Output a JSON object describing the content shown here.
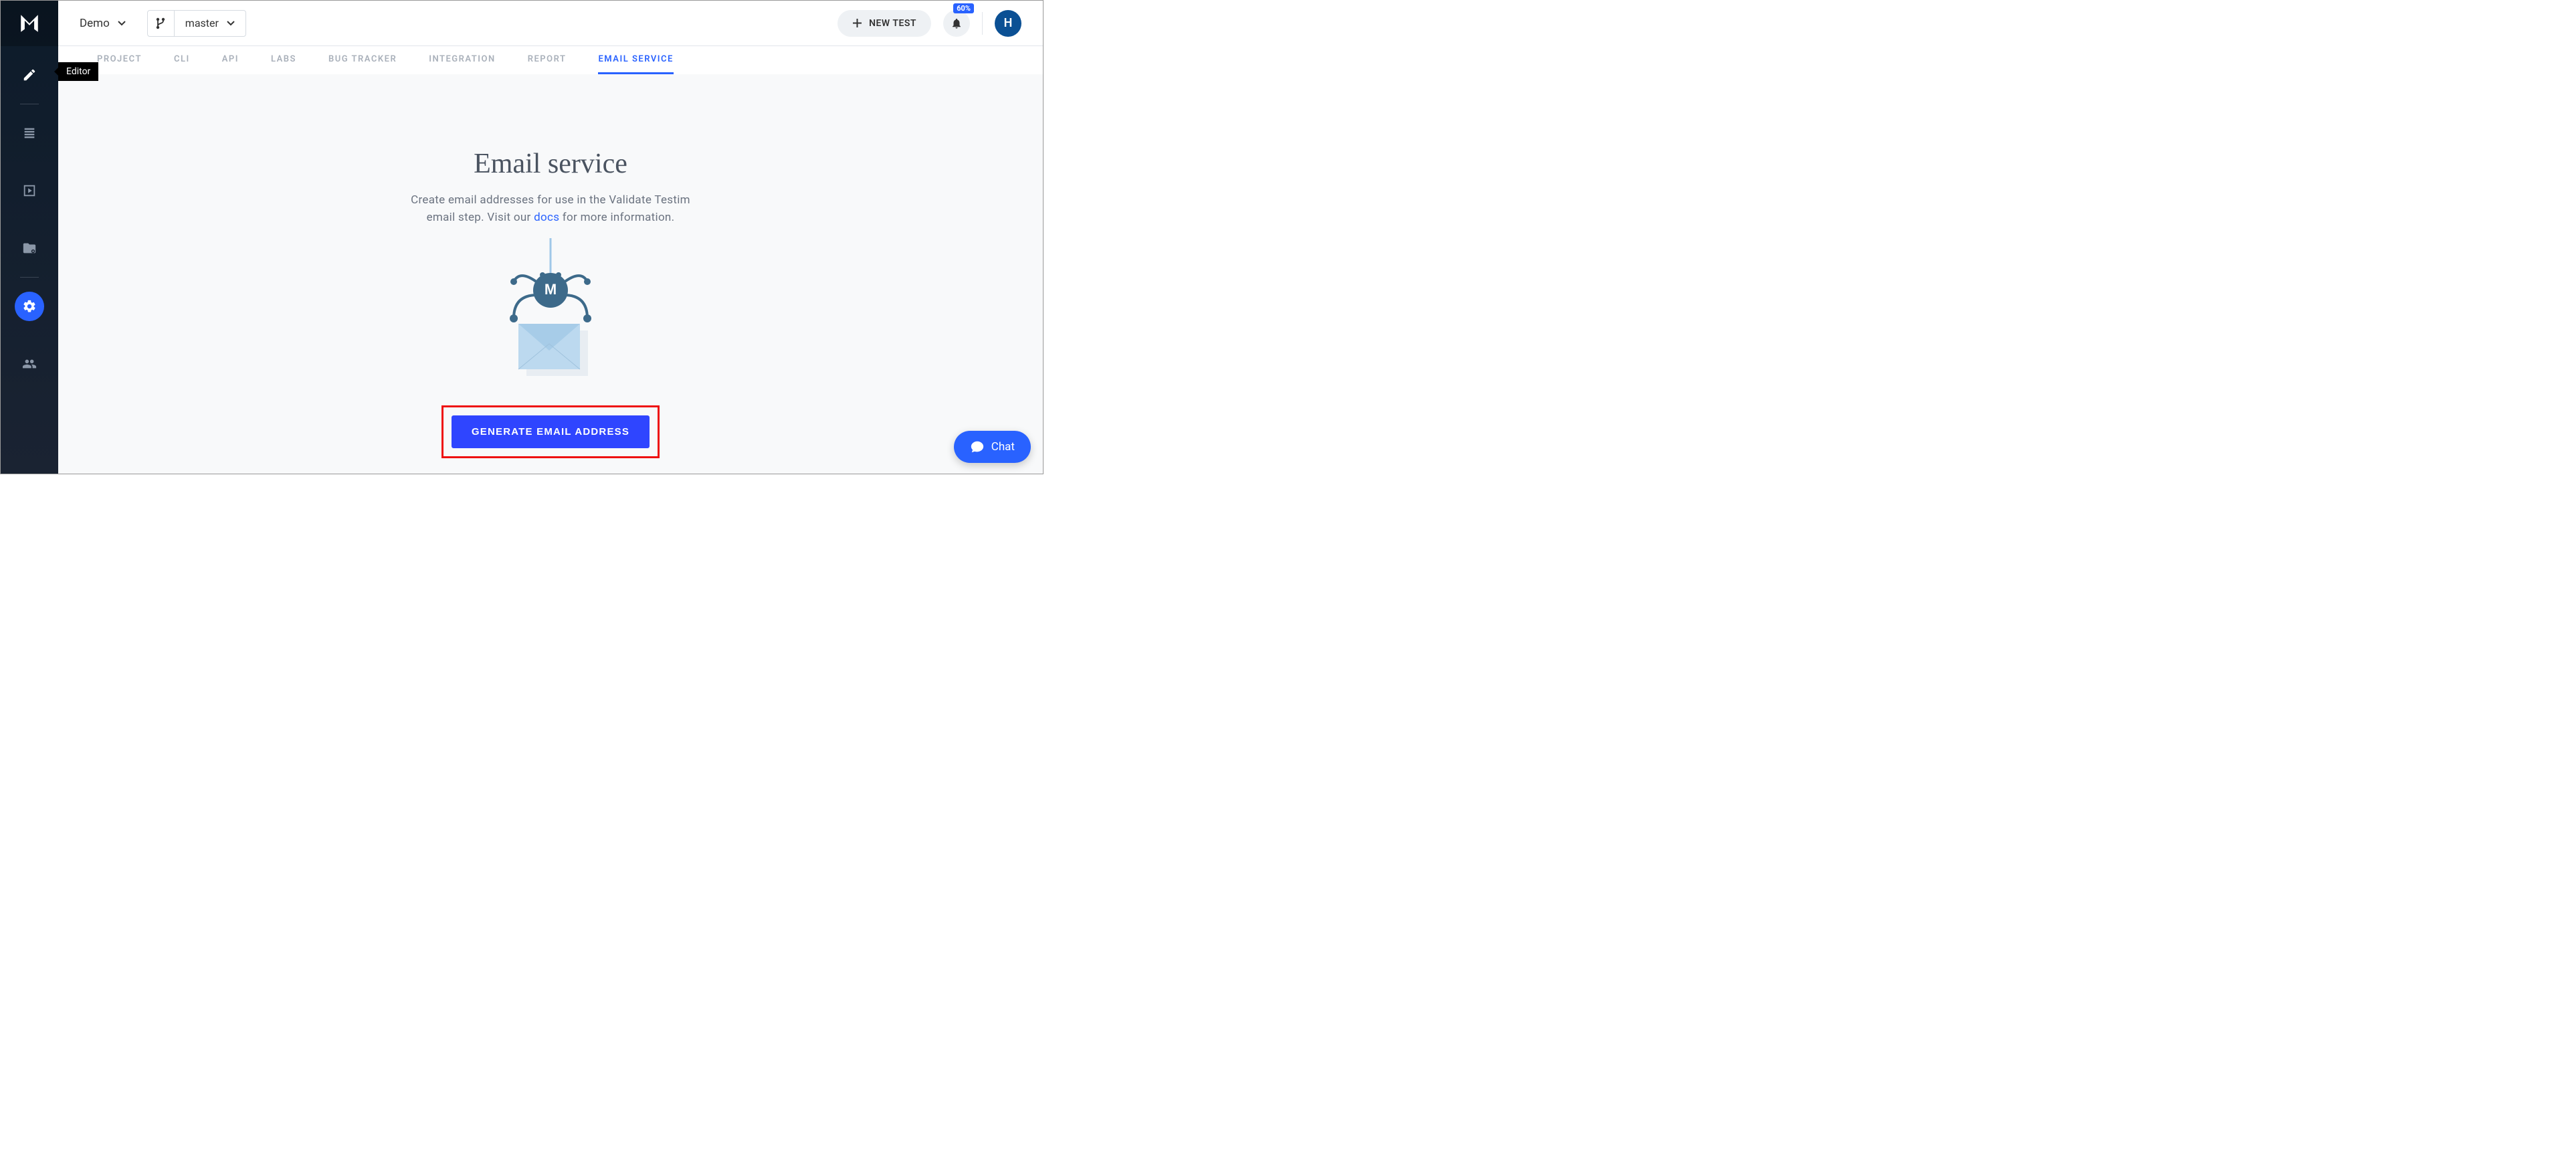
{
  "header": {
    "project_name": "Demo",
    "branch_name": "master",
    "new_test_label": "NEW TEST",
    "notification_badge": "60%",
    "avatar_letter": "H"
  },
  "sidebar": {
    "tooltip_editor": "Editor"
  },
  "tabs": [
    {
      "id": "project",
      "label": "PROJECT",
      "active": false
    },
    {
      "id": "cli",
      "label": "CLI",
      "active": false
    },
    {
      "id": "api",
      "label": "API",
      "active": false
    },
    {
      "id": "labs",
      "label": "LABS",
      "active": false
    },
    {
      "id": "bug-tracker",
      "label": "BUG TRACKER",
      "active": false
    },
    {
      "id": "integration",
      "label": "INTEGRATION",
      "active": false
    },
    {
      "id": "report",
      "label": "REPORT",
      "active": false
    },
    {
      "id": "email-service",
      "label": "EMAIL SERVICE",
      "active": true
    }
  ],
  "content": {
    "title": "Email service",
    "desc_1": "Create email addresses for use in the Validate Testim",
    "desc_2a": "email step. Visit our ",
    "docs_link": "docs",
    "desc_2b": " for more information.",
    "generate_btn": "GENERATE EMAIL ADDRESS"
  },
  "chat": {
    "label": "Chat"
  }
}
